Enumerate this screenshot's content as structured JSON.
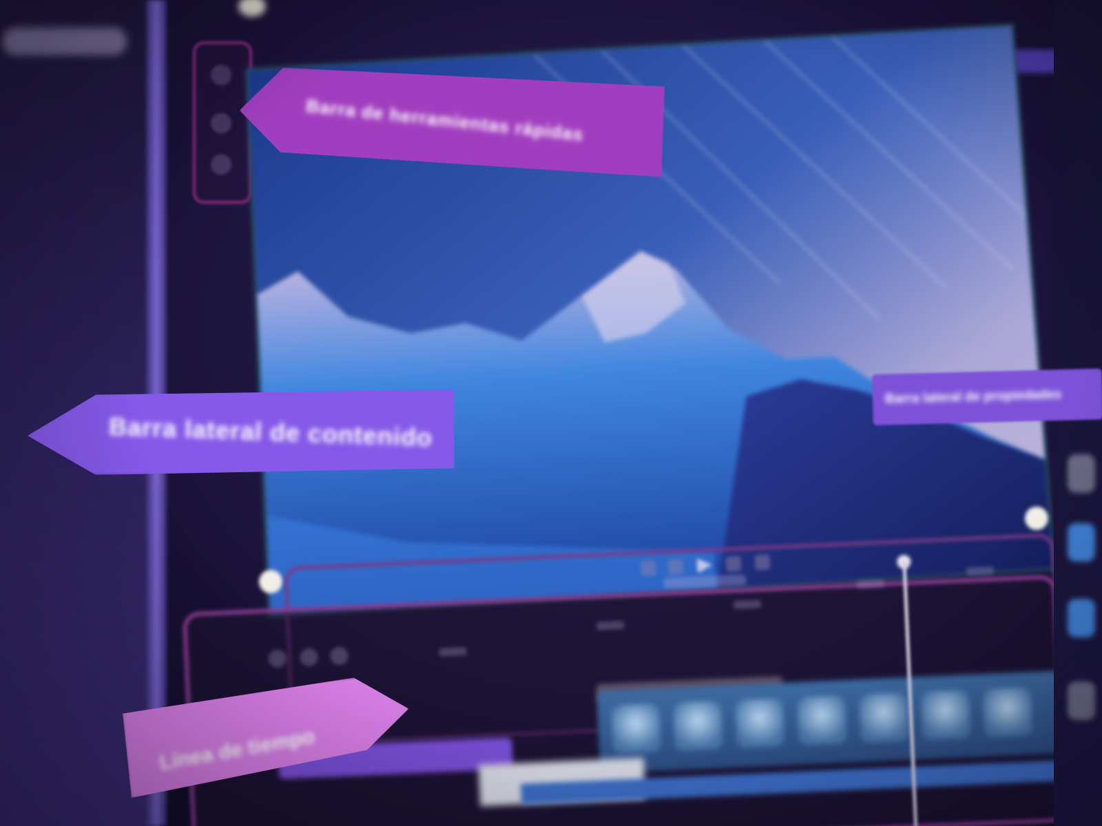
{
  "callouts": {
    "toolbar": "Barra de herramientas rápidas",
    "content": "Barra lateral de contenido",
    "properties": "Barra lateral de propiedades",
    "timeline": "Línea de tiempo"
  },
  "colors": {
    "toolbar_callout": "#a13ebf",
    "content_callout": "#8659e8",
    "properties_callout": "#7d52d8",
    "timeline_callout": "#d97fe6",
    "timeline_border": "#8a3d8f",
    "accent_button": "#4b3aa8",
    "video_track": "#3c6aa0"
  },
  "icons": {
    "toolbar": [
      "toolbar-tool-icon",
      "toolbar-tool-icon",
      "toolbar-tool-icon"
    ],
    "playback": [
      "skip-back-icon",
      "step-back-icon",
      "play-icon",
      "step-forward-icon",
      "skip-forward-icon"
    ],
    "timeline_tools": [
      "undo-icon",
      "redo-icon",
      "split-icon"
    ]
  }
}
